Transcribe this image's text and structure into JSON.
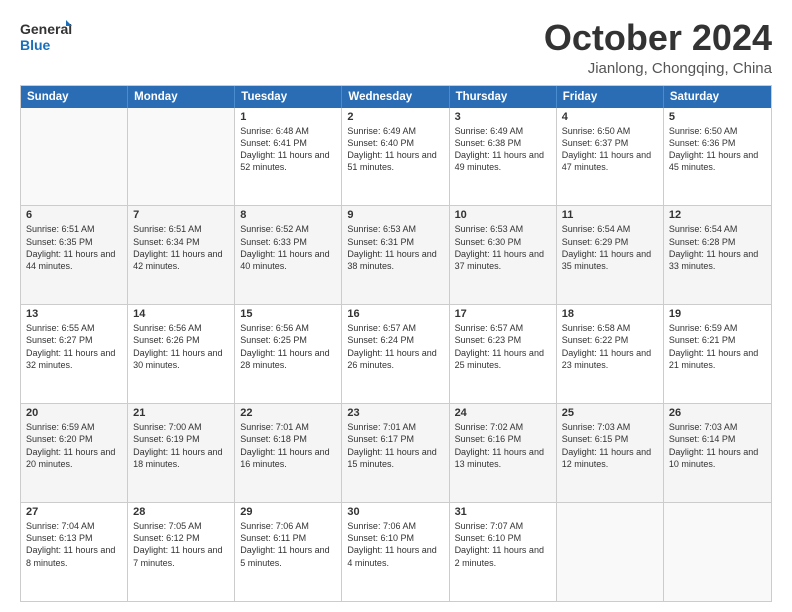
{
  "logo": {
    "line1": "General",
    "line2": "Blue"
  },
  "title": "October 2024",
  "location": "Jianlong, Chongqing, China",
  "days_of_week": [
    "Sunday",
    "Monday",
    "Tuesday",
    "Wednesday",
    "Thursday",
    "Friday",
    "Saturday"
  ],
  "weeks": [
    [
      {
        "day": "",
        "info": ""
      },
      {
        "day": "",
        "info": ""
      },
      {
        "day": "1",
        "info": "Sunrise: 6:48 AM\nSunset: 6:41 PM\nDaylight: 11 hours\nand 52 minutes."
      },
      {
        "day": "2",
        "info": "Sunrise: 6:49 AM\nSunset: 6:40 PM\nDaylight: 11 hours\nand 51 minutes."
      },
      {
        "day": "3",
        "info": "Sunrise: 6:49 AM\nSunset: 6:38 PM\nDaylight: 11 hours\nand 49 minutes."
      },
      {
        "day": "4",
        "info": "Sunrise: 6:50 AM\nSunset: 6:37 PM\nDaylight: 11 hours\nand 47 minutes."
      },
      {
        "day": "5",
        "info": "Sunrise: 6:50 AM\nSunset: 6:36 PM\nDaylight: 11 hours\nand 45 minutes."
      }
    ],
    [
      {
        "day": "6",
        "info": "Sunrise: 6:51 AM\nSunset: 6:35 PM\nDaylight: 11 hours\nand 44 minutes."
      },
      {
        "day": "7",
        "info": "Sunrise: 6:51 AM\nSunset: 6:34 PM\nDaylight: 11 hours\nand 42 minutes."
      },
      {
        "day": "8",
        "info": "Sunrise: 6:52 AM\nSunset: 6:33 PM\nDaylight: 11 hours\nand 40 minutes."
      },
      {
        "day": "9",
        "info": "Sunrise: 6:53 AM\nSunset: 6:31 PM\nDaylight: 11 hours\nand 38 minutes."
      },
      {
        "day": "10",
        "info": "Sunrise: 6:53 AM\nSunset: 6:30 PM\nDaylight: 11 hours\nand 37 minutes."
      },
      {
        "day": "11",
        "info": "Sunrise: 6:54 AM\nSunset: 6:29 PM\nDaylight: 11 hours\nand 35 minutes."
      },
      {
        "day": "12",
        "info": "Sunrise: 6:54 AM\nSunset: 6:28 PM\nDaylight: 11 hours\nand 33 minutes."
      }
    ],
    [
      {
        "day": "13",
        "info": "Sunrise: 6:55 AM\nSunset: 6:27 PM\nDaylight: 11 hours\nand 32 minutes."
      },
      {
        "day": "14",
        "info": "Sunrise: 6:56 AM\nSunset: 6:26 PM\nDaylight: 11 hours\nand 30 minutes."
      },
      {
        "day": "15",
        "info": "Sunrise: 6:56 AM\nSunset: 6:25 PM\nDaylight: 11 hours\nand 28 minutes."
      },
      {
        "day": "16",
        "info": "Sunrise: 6:57 AM\nSunset: 6:24 PM\nDaylight: 11 hours\nand 26 minutes."
      },
      {
        "day": "17",
        "info": "Sunrise: 6:57 AM\nSunset: 6:23 PM\nDaylight: 11 hours\nand 25 minutes."
      },
      {
        "day": "18",
        "info": "Sunrise: 6:58 AM\nSunset: 6:22 PM\nDaylight: 11 hours\nand 23 minutes."
      },
      {
        "day": "19",
        "info": "Sunrise: 6:59 AM\nSunset: 6:21 PM\nDaylight: 11 hours\nand 21 minutes."
      }
    ],
    [
      {
        "day": "20",
        "info": "Sunrise: 6:59 AM\nSunset: 6:20 PM\nDaylight: 11 hours\nand 20 minutes."
      },
      {
        "day": "21",
        "info": "Sunrise: 7:00 AM\nSunset: 6:19 PM\nDaylight: 11 hours\nand 18 minutes."
      },
      {
        "day": "22",
        "info": "Sunrise: 7:01 AM\nSunset: 6:18 PM\nDaylight: 11 hours\nand 16 minutes."
      },
      {
        "day": "23",
        "info": "Sunrise: 7:01 AM\nSunset: 6:17 PM\nDaylight: 11 hours\nand 15 minutes."
      },
      {
        "day": "24",
        "info": "Sunrise: 7:02 AM\nSunset: 6:16 PM\nDaylight: 11 hours\nand 13 minutes."
      },
      {
        "day": "25",
        "info": "Sunrise: 7:03 AM\nSunset: 6:15 PM\nDaylight: 11 hours\nand 12 minutes."
      },
      {
        "day": "26",
        "info": "Sunrise: 7:03 AM\nSunset: 6:14 PM\nDaylight: 11 hours\nand 10 minutes."
      }
    ],
    [
      {
        "day": "27",
        "info": "Sunrise: 7:04 AM\nSunset: 6:13 PM\nDaylight: 11 hours\nand 8 minutes."
      },
      {
        "day": "28",
        "info": "Sunrise: 7:05 AM\nSunset: 6:12 PM\nDaylight: 11 hours\nand 7 minutes."
      },
      {
        "day": "29",
        "info": "Sunrise: 7:06 AM\nSunset: 6:11 PM\nDaylight: 11 hours\nand 5 minutes."
      },
      {
        "day": "30",
        "info": "Sunrise: 7:06 AM\nSunset: 6:10 PM\nDaylight: 11 hours\nand 4 minutes."
      },
      {
        "day": "31",
        "info": "Sunrise: 7:07 AM\nSunset: 6:10 PM\nDaylight: 11 hours\nand 2 minutes."
      },
      {
        "day": "",
        "info": ""
      },
      {
        "day": "",
        "info": ""
      }
    ]
  ]
}
